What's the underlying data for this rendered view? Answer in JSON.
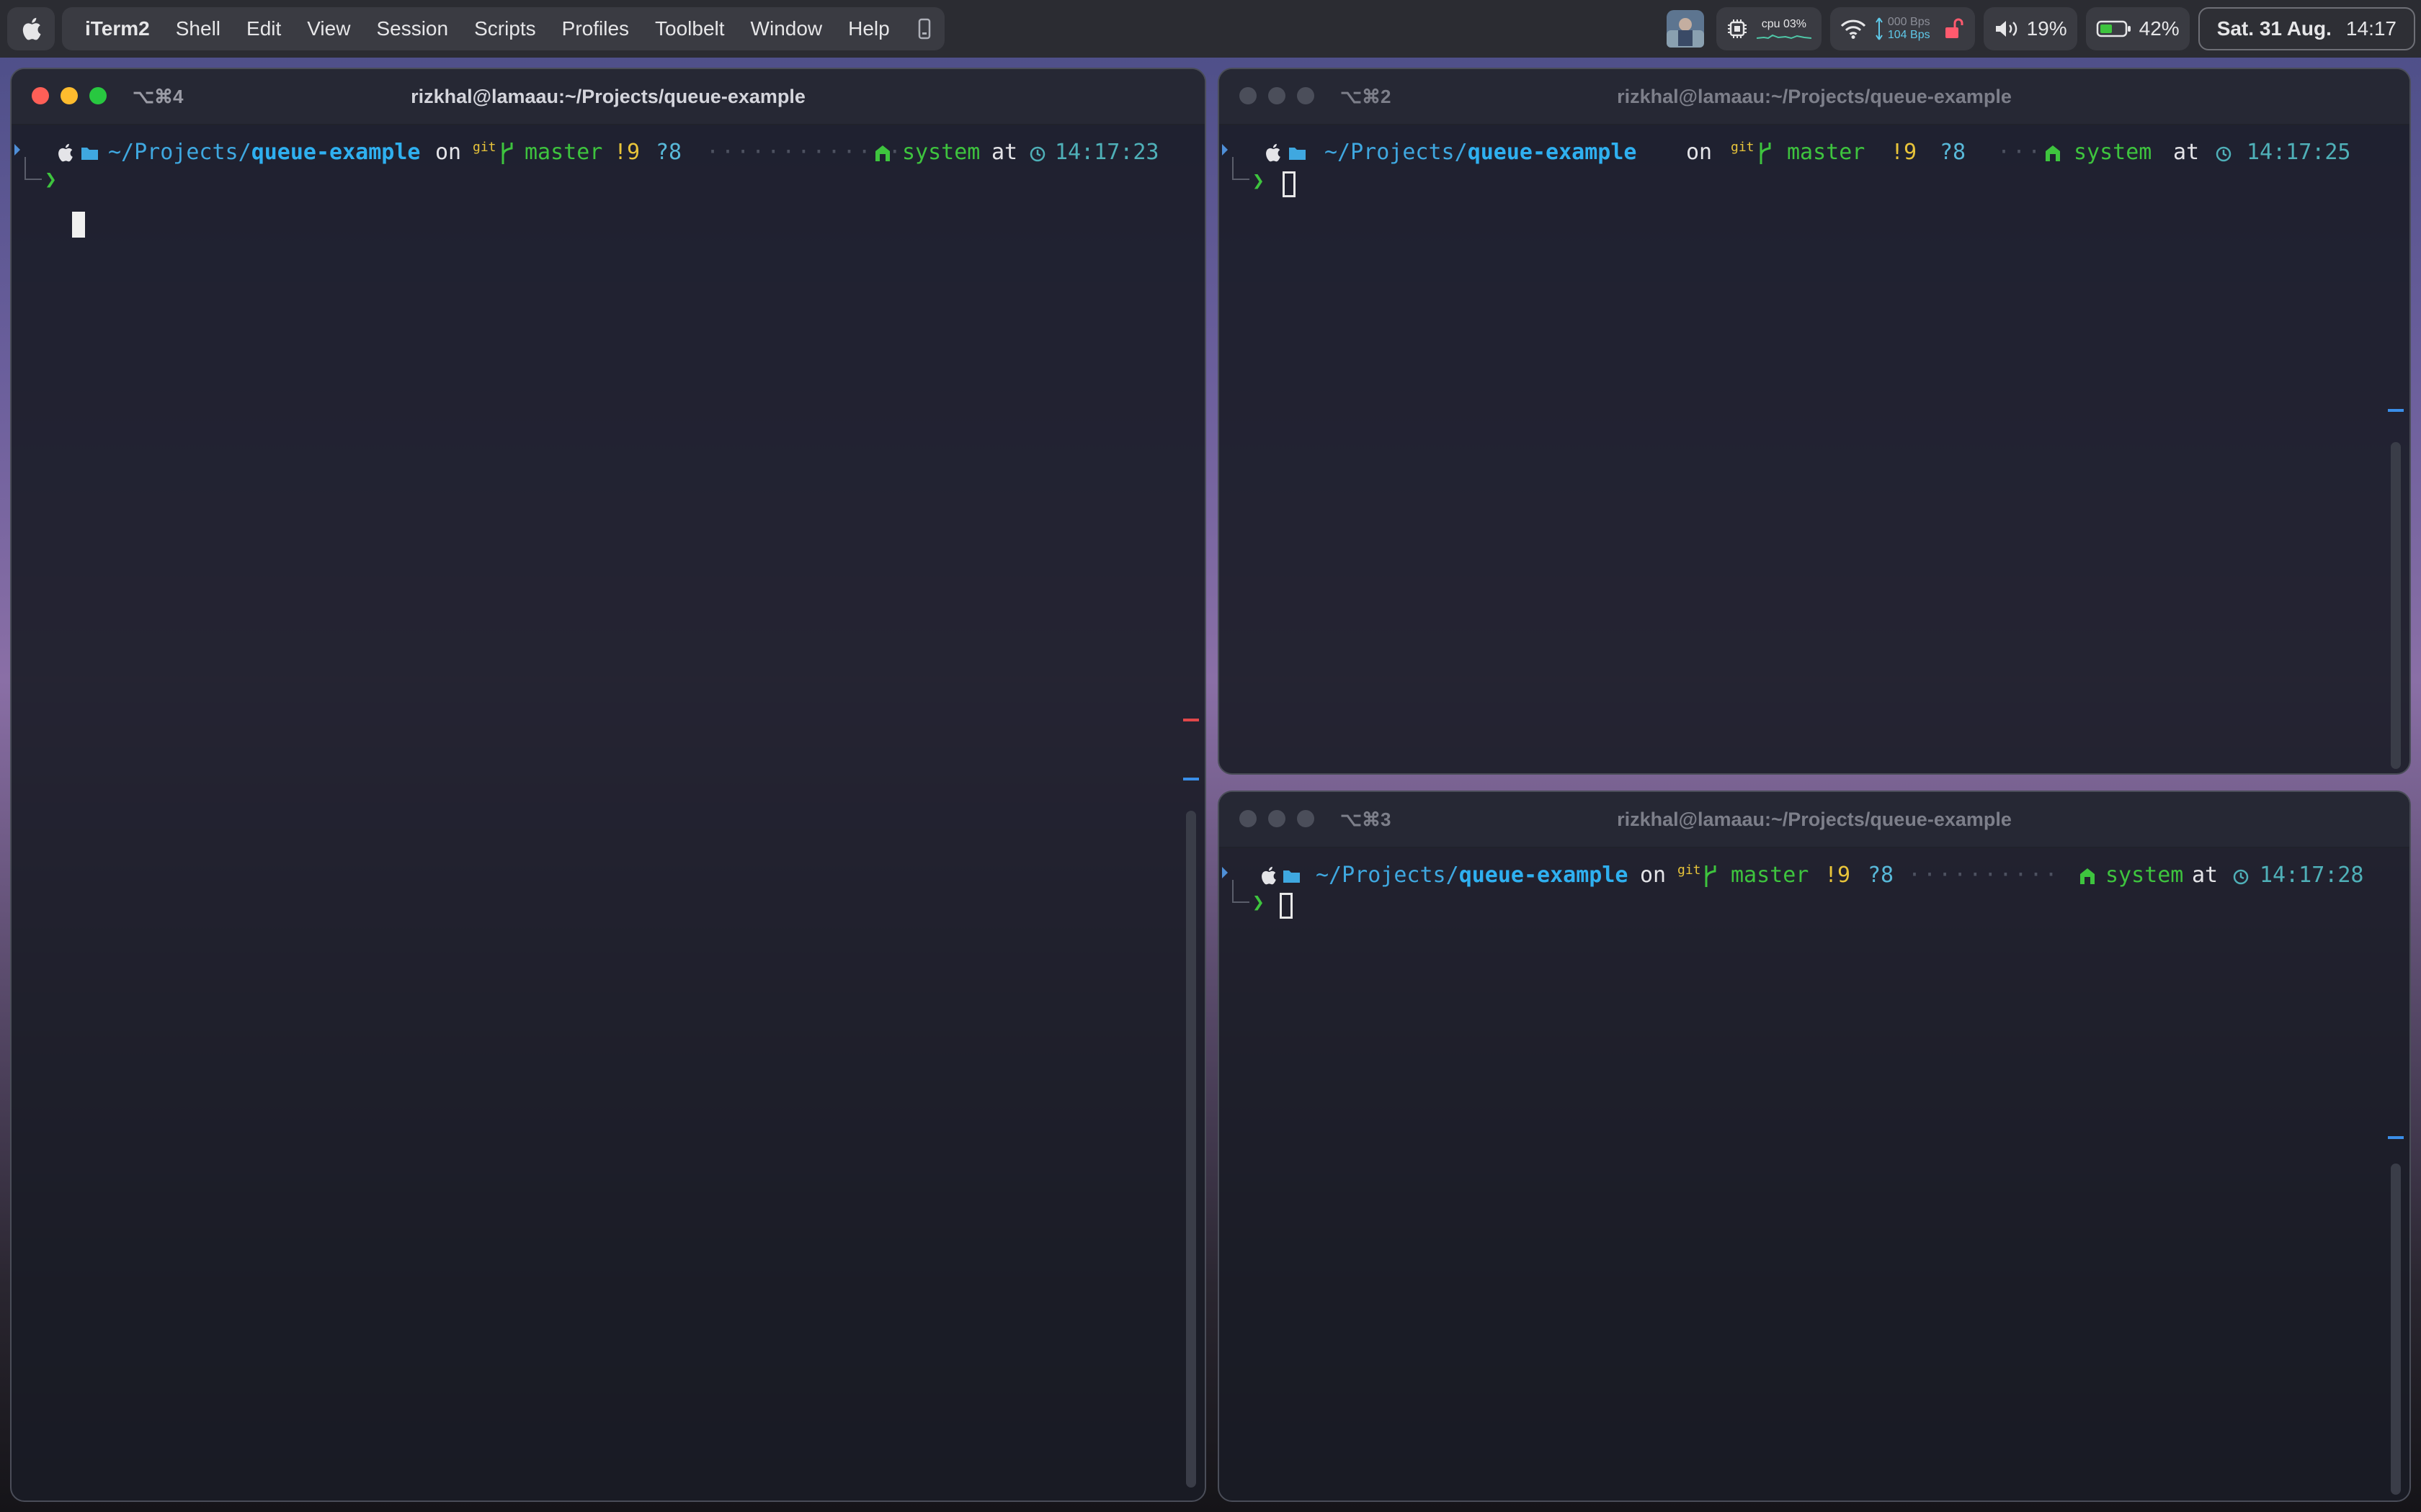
{
  "menubar": {
    "app_name": "iTerm2",
    "menus": [
      "Shell",
      "Edit",
      "View",
      "Session",
      "Scripts",
      "Profiles",
      "Toolbelt",
      "Window",
      "Help"
    ],
    "cpu_label": "cpu 03%",
    "net_up": "000 Bps",
    "net_down": "104 Bps",
    "volume": "19%",
    "battery": "42%",
    "date": "Sat. 31 Aug.",
    "time": "14:17"
  },
  "colors": {
    "accent_red": "#fe5f57",
    "accent_yellow": "#febc2e",
    "accent_green": "#28c840",
    "prompt_path": "#3fa8e0",
    "prompt_git": "#3ec43e",
    "prompt_status": "#e8c43a",
    "lock_red": "#ff5a6e"
  },
  "windows": [
    {
      "id": "left",
      "shortcut": "⌥⌘4",
      "title": "rizkhal@lamaau:~/Projects/queue-example",
      "prompt": {
        "path_prefix": "~/Projects/",
        "path_dir": "queue-example",
        "on": "on",
        "git": "git",
        "branch": "master",
        "modified": "!9",
        "untracked": "?8",
        "dots": "·············",
        "env": "system",
        "at": "at",
        "time": "14:17:23"
      }
    },
    {
      "id": "top-right",
      "shortcut": "⌥⌘2",
      "title": "rizkhal@lamaau:~/Projects/queue-example",
      "prompt": {
        "path_prefix": "~/Projects/",
        "path_dir": "queue-example",
        "on": "on",
        "git": "git",
        "branch": "master",
        "modified": "!9",
        "untracked": "?8",
        "dots": "····",
        "env": "system",
        "at": "at",
        "time": "14:17:25"
      }
    },
    {
      "id": "bottom-right",
      "shortcut": "⌥⌘3",
      "title": "rizkhal@lamaau:~/Projects/queue-example",
      "prompt": {
        "path_prefix": "~/Projects/",
        "path_dir": "queue-example",
        "on": "on",
        "git": "git",
        "branch": "master",
        "modified": "!9",
        "untracked": "?8",
        "dots": "··········",
        "env": "system",
        "at": "at",
        "time": "14:17:28"
      }
    }
  ],
  "prompt_char": "❯"
}
